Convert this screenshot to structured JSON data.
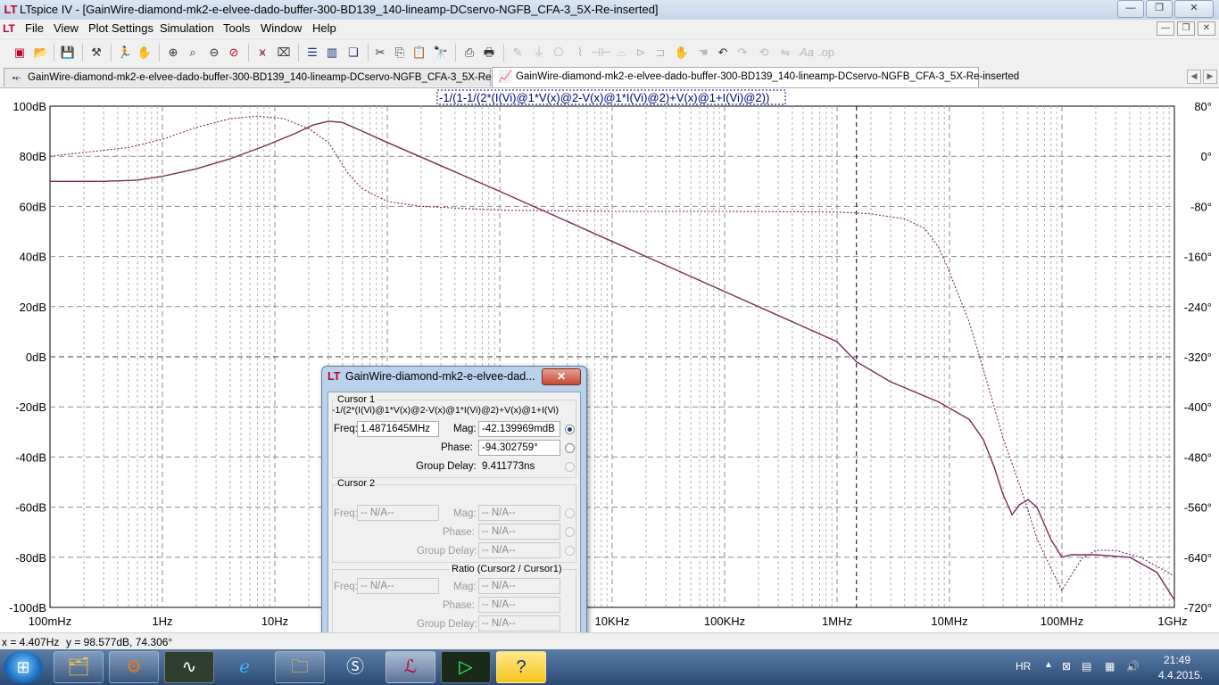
{
  "window": {
    "title": "LTspice IV - [GainWire-diamond-mk2-e-elvee-dado-buffer-300-BD139_140-lineamp-DCservo-NGFB_CFA-3_5X-Re-inserted]",
    "controls": [
      "minimize",
      "maximize",
      "close"
    ]
  },
  "menu": {
    "items": [
      "File",
      "View",
      "Plot Settings",
      "Simulation",
      "Tools",
      "Window",
      "Help"
    ]
  },
  "toolbar": {
    "icons": [
      "new-schematic-icon",
      "open-icon",
      "save-icon",
      "control-panel-icon",
      "run-icon",
      "halt-icon",
      "zoom-in-icon",
      "zoom-area-icon",
      "zoom-out-icon",
      "zoom-cancel-icon",
      "autorange-icon",
      "fit-icon",
      "tile-horizontal-icon",
      "tile-vertical-icon",
      "cascade-icon",
      "cut-icon",
      "copy-icon",
      "paste-icon",
      "find-icon",
      "print-preview-icon",
      "print-icon",
      "wire-icon",
      "ground-icon",
      "label-icon",
      "resistor-icon",
      "capacitor-icon",
      "inductor-icon",
      "diode-icon",
      "component-icon",
      "move-icon",
      "drag-icon",
      "undo-icon",
      "redo-icon",
      "rotate-icon",
      "mirror-icon",
      "text-icon",
      "spice-directive-icon"
    ]
  },
  "tabs": [
    {
      "label": "GainWire-diamond-mk2-e-elvee-dado-buffer-300-BD139_140-lineamp-DCservo-NGFB_CFA-3_5X-Re-inserted",
      "icon": "schematic-icon",
      "active": false
    },
    {
      "label": "GainWire-diamond-mk2-e-elvee-dado-buffer-300-BD139_140-lineamp-DCservo-NGFB_CFA-3_5X-Re-inserted",
      "icon": "waveform-icon",
      "active": true
    }
  ],
  "chart_data": {
    "type": "line",
    "title": "-1/(1-1/(2*(I(Vi)@1*V(x)@2-V(x)@1*I(Vi)@2)+V(x)@1+I(Vi)@2))",
    "xscale": "log",
    "xlim": [
      0.1,
      1000000000
    ],
    "x_ticks": [
      "100mHz",
      "1Hz",
      "10Hz",
      "100Hz",
      "1KHz",
      "10KHz",
      "100KHz",
      "1MHz",
      "10MHz",
      "100MHz",
      "1GHz"
    ],
    "left_axis": {
      "unit": "dB",
      "ylim": [
        -100,
        100
      ],
      "ticks": [
        "100dB",
        "80dB",
        "60dB",
        "40dB",
        "20dB",
        "0dB",
        "-20dB",
        "-40dB",
        "-60dB",
        "-80dB",
        "-100dB"
      ]
    },
    "right_axis": {
      "unit": "°",
      "ylim": [
        -720,
        80
      ],
      "ticks": [
        "80°",
        "0°",
        "-80°",
        "-160°",
        "-240°",
        "-320°",
        "-400°",
        "-480°",
        "-560°",
        "-640°",
        "-720°"
      ]
    },
    "grid": true,
    "cursor_freq": 1487164.5,
    "series": [
      {
        "style": "solid",
        "axis": "left",
        "color": "#7b2a5a",
        "x": [
          0.1,
          0.3,
          0.6,
          1,
          2,
          4,
          8,
          15,
          22,
          30,
          40,
          60,
          100,
          1000,
          10000,
          100000,
          1000000,
          1487164,
          3000000,
          8000000,
          15000000,
          20000000,
          25000000,
          30000000,
          36000000,
          42000000,
          50000000,
          60000000,
          70000000,
          80000000,
          100000000,
          120000000,
          200000000,
          400000000,
          700000000,
          1000000000
        ],
        "y": [
          70,
          70,
          70.5,
          72,
          75,
          79,
          84,
          89,
          92.5,
          94,
          93.5,
          90,
          85.5,
          66,
          46,
          26,
          6,
          -2,
          -10,
          -18,
          -25,
          -33,
          -44,
          -55,
          -63,
          -59,
          -57,
          -60,
          -67,
          -73,
          -80,
          -79,
          -79,
          -80,
          -86,
          -97
        ]
      },
      {
        "style": "dashed",
        "axis": "right",
        "color": "#7b2a5a",
        "x": [
          0.1,
          0.5,
          1,
          2,
          4,
          7,
          12,
          20,
          30,
          45,
          60,
          100,
          200,
          1000,
          10000,
          100000,
          1000000,
          2000000,
          4000000,
          6000000,
          8000000,
          10000000,
          15000000,
          20000000,
          30000000,
          45000000,
          60000000,
          80000000,
          100000000,
          120000000,
          150000000,
          200000000,
          300000000,
          500000000,
          1000000000
        ],
        "y": [
          0,
          14,
          27,
          46,
          60,
          64,
          60,
          44,
          22,
          -28,
          -52,
          -72,
          -80,
          -86,
          -88,
          -88,
          -89,
          -92,
          -100,
          -115,
          -145,
          -185,
          -265,
          -340,
          -450,
          -540,
          -610,
          -658,
          -693,
          -670,
          -642,
          -629,
          -629,
          -640,
          -670
        ]
      }
    ]
  },
  "cursor_dialog": {
    "title": "GainWire-diamond-mk2-e-elvee-dad...",
    "cursor1": {
      "group_label": "Cursor 1",
      "expression": "-1/(2*(I(Vi)@1*V(x)@2-V(x)@1*I(Vi)@2)+V(x)@1+I(Vi)",
      "freq_label": "Freq:",
      "freq": "1.4871645MHz",
      "mag_label": "Mag:",
      "mag": "-42.139969mdB",
      "phase_label": "Phase:",
      "phase": "-94.302759°",
      "group_delay_label": "Group Delay:",
      "group_delay": "9.411773ns"
    },
    "cursor2": {
      "group_label": "Cursor 2",
      "freq_label": "Freq:",
      "freq": "-- N/A--",
      "mag_label": "Mag:",
      "mag": "-- N/A--",
      "phase_label": "Phase:",
      "phase": "-- N/A--",
      "group_delay_label": "Group Delay:",
      "group_delay": "-- N/A--"
    },
    "ratio": {
      "group_label": "Ratio (Cursor2 / Cursor1)",
      "freq_label": "Freq:",
      "freq": "-- N/A--",
      "mag_label": "Mag:",
      "mag": "-- N/A--",
      "phase_label": "Phase:",
      "phase": "-- N/A--",
      "group_delay_label": "Group Delay:",
      "group_delay": "-- N/A--"
    }
  },
  "status": {
    "x": "x = 4.407Hz",
    "y": "y = 98.577dB, 74.306°"
  },
  "taskbar": {
    "items": [
      "start-orb-icon",
      "file-explorer-icon",
      "installer-icon",
      "oscilloscope-icon",
      "internet-explorer-icon",
      "folder-icon",
      "skype-icon",
      "ltspice-icon",
      "ltspice-waveform-icon",
      "help-icon"
    ],
    "language": "HR",
    "time": "21:49",
    "date": "4.4.2015."
  }
}
